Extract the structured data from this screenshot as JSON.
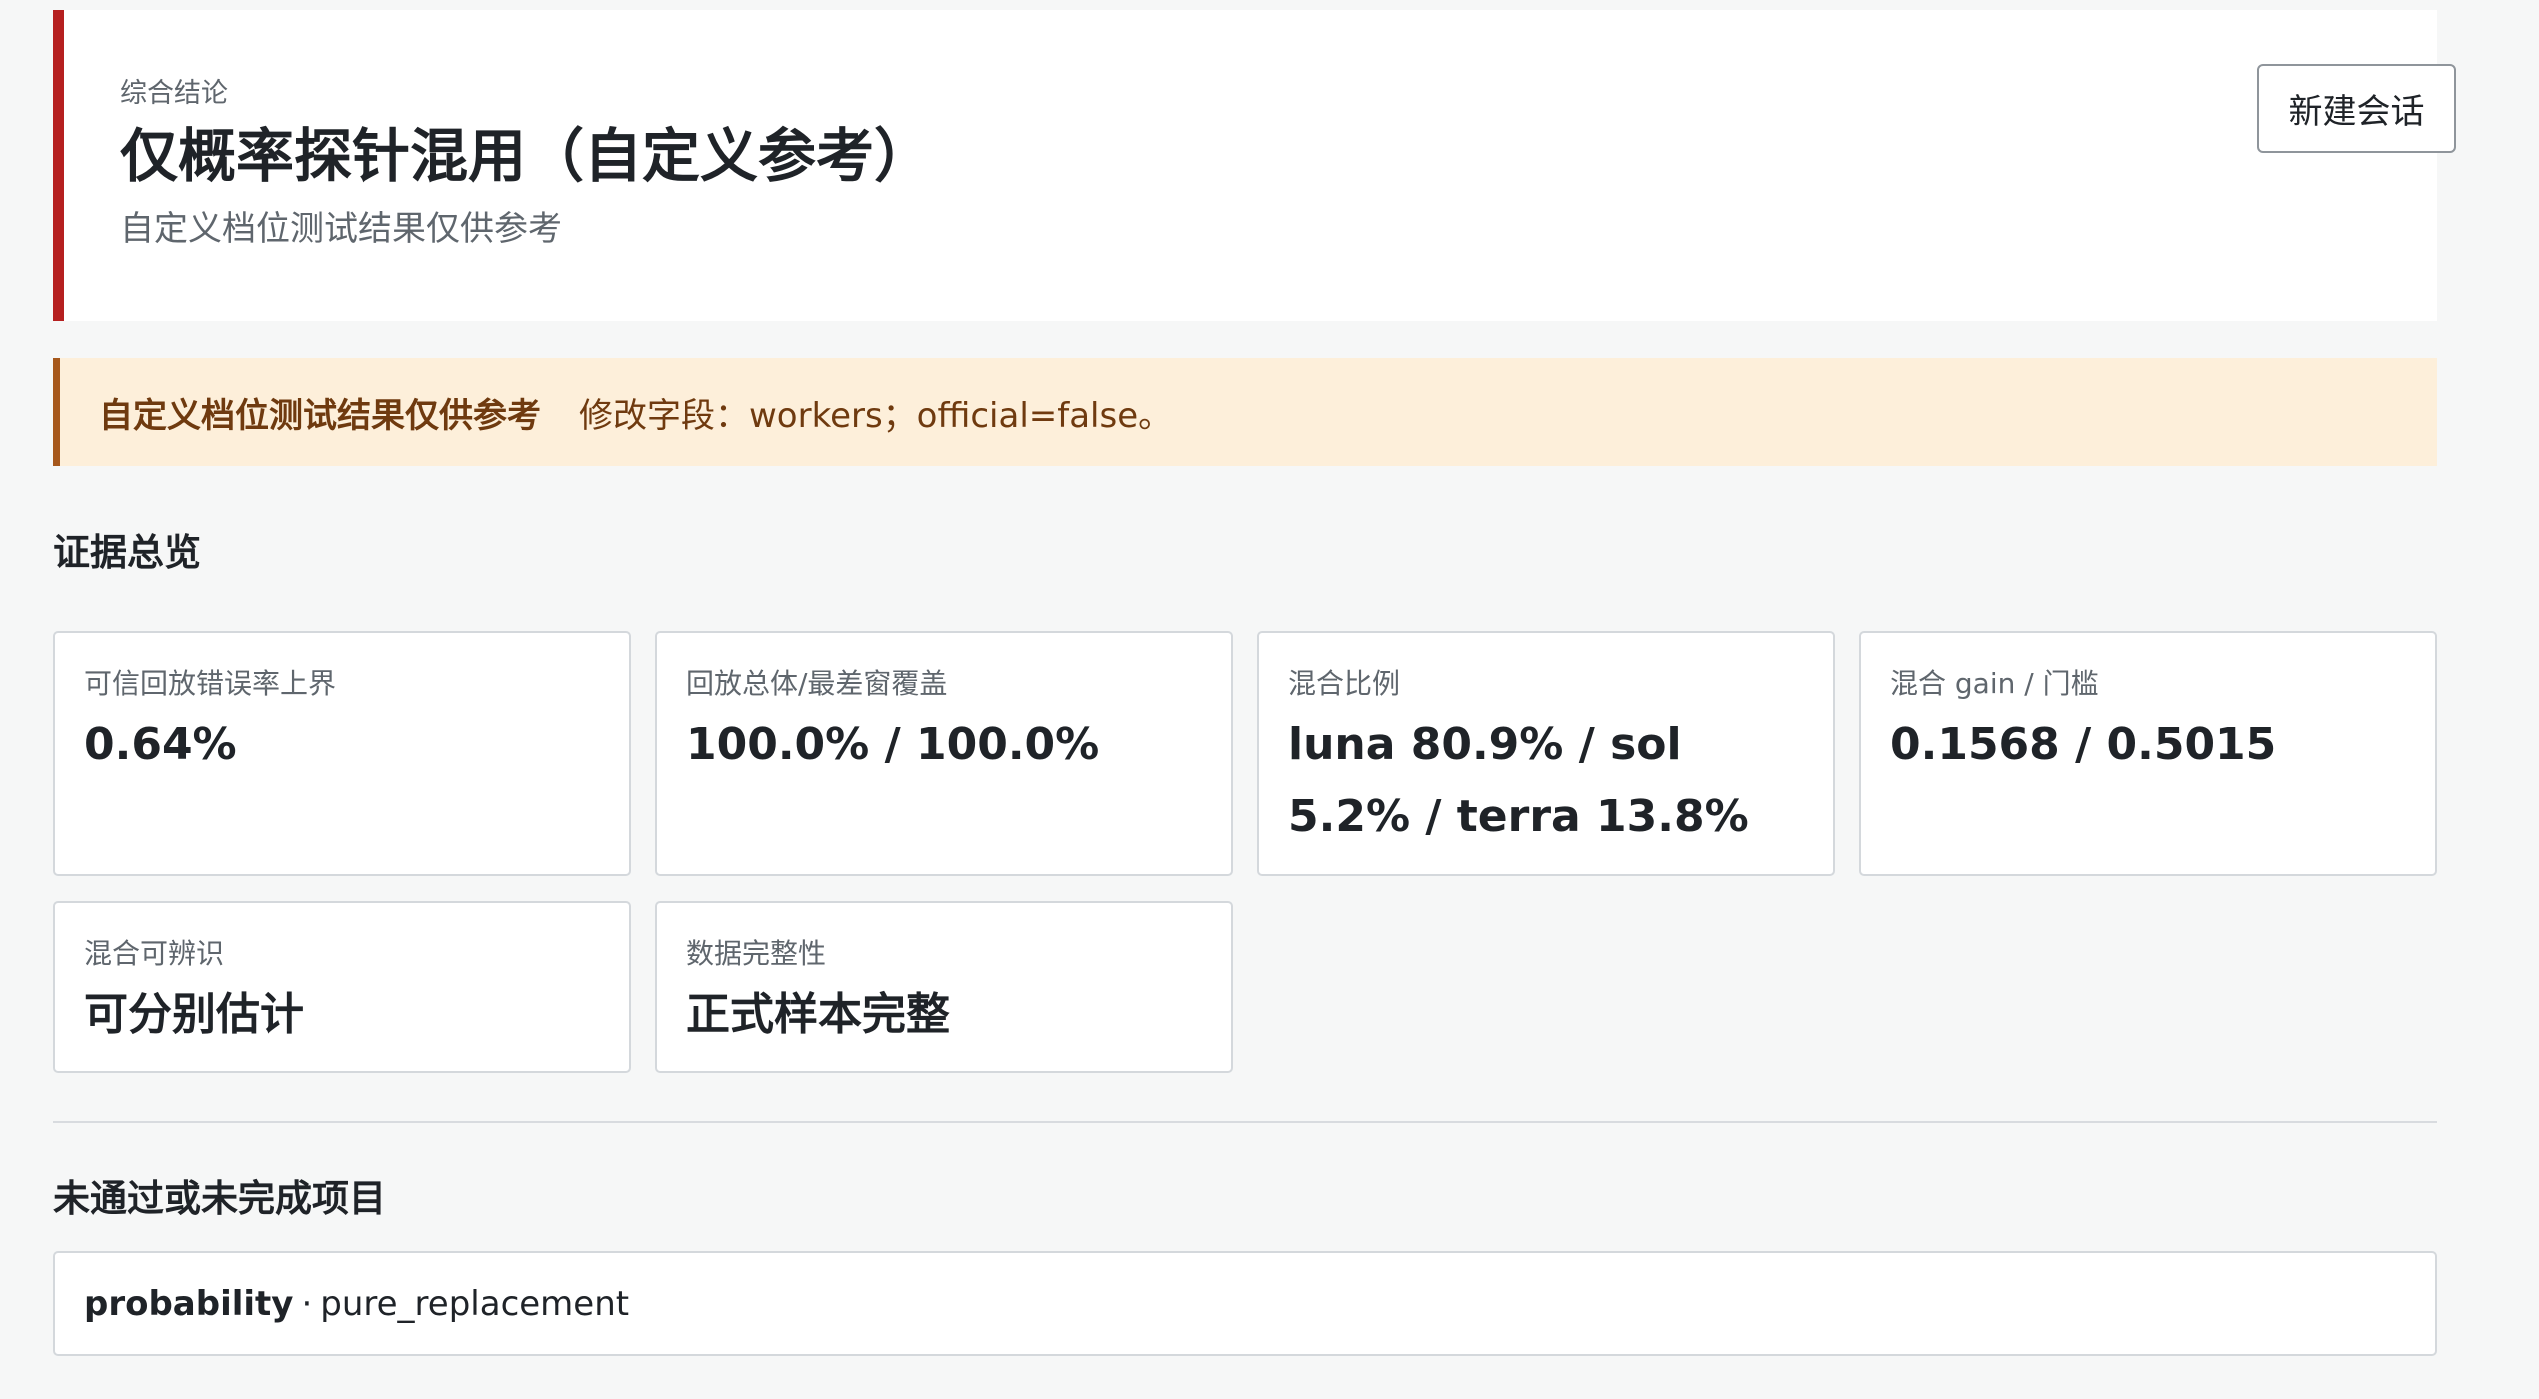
{
  "header": {
    "eyebrow": "综合结论",
    "title": "仅概率探针混用（自定义参考）",
    "subtitle": "自定义档位测试结果仅供参考",
    "new_session_label": "新建会话",
    "accent_color": "#b52020"
  },
  "warning": {
    "title": "自定义档位测试结果仅供参考",
    "detail": "修改字段：workers；official=false。",
    "background": "#fdefda",
    "accent_color": "#a6581c"
  },
  "evidence": {
    "heading": "证据总览",
    "cards": [
      {
        "label": "可信回放错误率上界",
        "value": "0.64%"
      },
      {
        "label": "回放总体/最差窗覆盖",
        "value": "100.0% / 100.0%"
      },
      {
        "label": "混合比例",
        "value": "luna 80.9% / sol 5.2% / terra 13.8%"
      },
      {
        "label": "混合 gain / 门槛",
        "value": "0.1568 / 0.5015"
      },
      {
        "label": "混合可辨识",
        "value": "可分别估计"
      },
      {
        "label": "数据完整性",
        "value": "正式样本完整"
      }
    ]
  },
  "failures": {
    "heading": "未通过或未完成项目",
    "items": [
      {
        "key": "probability",
        "separator": "·",
        "value": "pure_replacement"
      }
    ]
  }
}
